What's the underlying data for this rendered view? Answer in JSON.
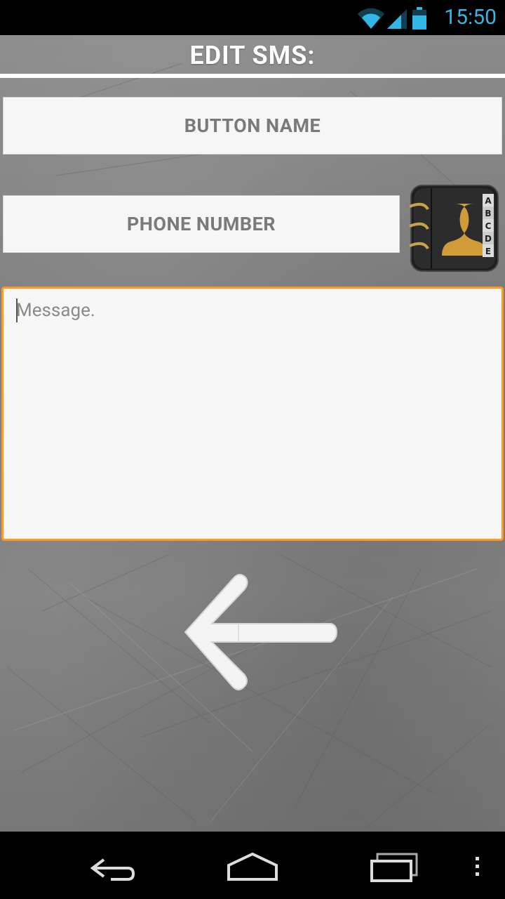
{
  "status": {
    "time": "15:50"
  },
  "header": {
    "title": "EDIT SMS:"
  },
  "form": {
    "button_name_placeholder": "BUTTON NAME",
    "phone_number_placeholder": "PHONE NUMBER",
    "message_placeholder": "Message."
  },
  "contacts_tabs": [
    "A",
    "B",
    "C",
    "D",
    "E"
  ],
  "colors": {
    "accent": "#33b5e5",
    "focus": "#ff9a1f",
    "text_muted": "#7a7a7a"
  },
  "icons": {
    "wifi": "wifi-icon",
    "signal": "signal-icon",
    "battery": "battery-icon",
    "contacts": "contacts-book-icon",
    "back_arrow": "arrow-left-icon",
    "nav_back": "nav-back-icon",
    "nav_home": "nav-home-icon",
    "nav_recent": "nav-recent-apps-icon",
    "nav_menu": "nav-menu-icon"
  }
}
